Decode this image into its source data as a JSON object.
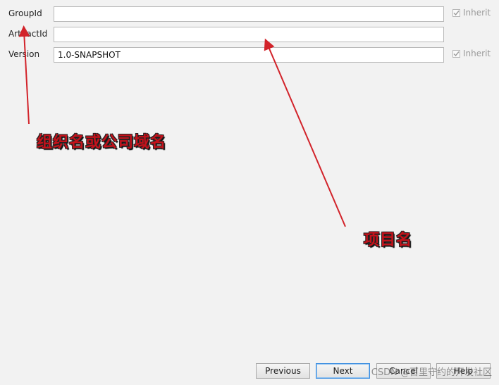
{
  "form": {
    "group_id": {
      "label": "GroupId",
      "value": "",
      "inherit_label": "Inherit",
      "inherit_checked": true
    },
    "artifact_id": {
      "label": "ArtifactId",
      "value": ""
    },
    "version": {
      "label": "Version",
      "value": "1.0-SNAPSHOT",
      "inherit_label": "Inherit",
      "inherit_checked": true
    }
  },
  "annotations": {
    "org_domain": "组织名或公司域名",
    "project_name": "项目名"
  },
  "buttons": {
    "previous": "Previous",
    "next": "Next",
    "cancel": "Cancel",
    "help": "Help"
  },
  "watermark": "CSDN @百里守约的开发社区",
  "colors": {
    "annotation_red": "#c4121b",
    "primary_border": "#3b8de0"
  }
}
